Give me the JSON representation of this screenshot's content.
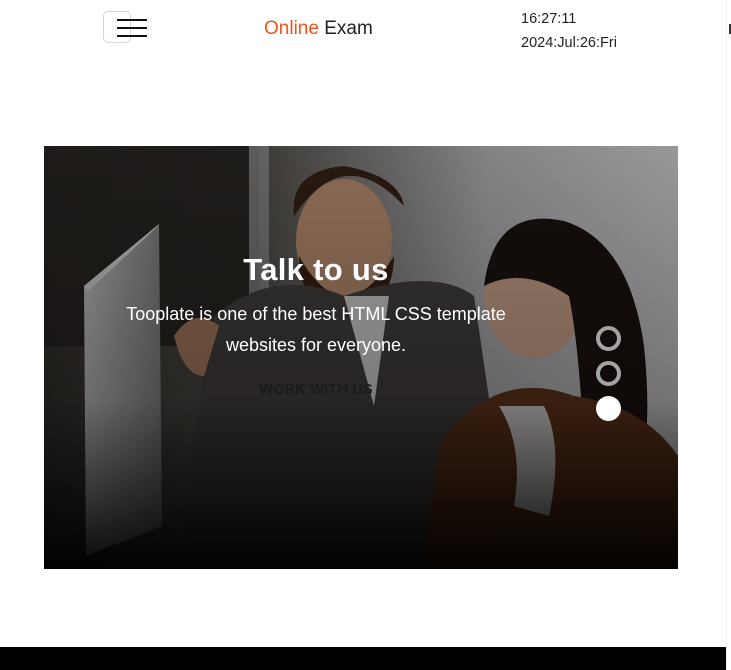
{
  "header": {
    "brand_accent": "Online",
    "brand_rest": "Exam",
    "clock_time": "16:27:11",
    "clock_date": "2024:Jul:26:Fri"
  },
  "hero": {
    "title": "Talk to us",
    "text": "Tooplate is one of the best HTML CSS template websites for everyone.",
    "cta_label": "WORK WITH US",
    "active_slide": 3,
    "slide_count": 3
  },
  "colors": {
    "accent": "#f0531c",
    "text": "#222222",
    "footer": "#000000"
  }
}
